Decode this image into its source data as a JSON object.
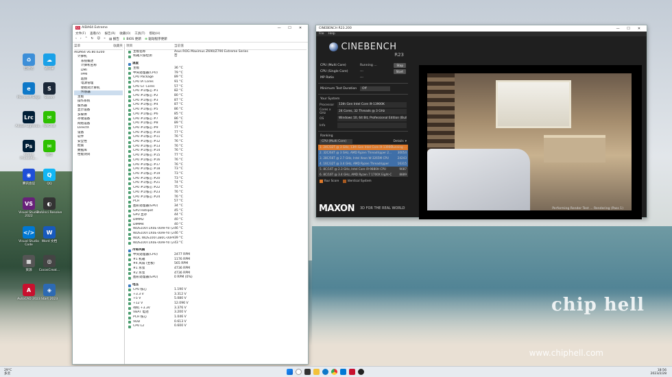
{
  "desktop": {
    "icons": [
      {
        "label": "回收站",
        "color": "#3d8fd8",
        "glyph": "♻"
      },
      {
        "label": "通讯录",
        "color": "#1aa1e8",
        "glyph": "☁"
      },
      {
        "label": "Microsoft Edge",
        "color": "#0d78c8",
        "glyph": "e"
      },
      {
        "label": "Steam",
        "color": "#1b2838",
        "glyph": "S"
      },
      {
        "label": "Adobe Lightroo...",
        "color": "#001e36",
        "glyph": "Lrc"
      },
      {
        "label": "WeChat",
        "color": "#2dc100",
        "glyph": "✉"
      },
      {
        "label": "Adobe Photosho...",
        "color": "#001e36",
        "glyph": "Ps"
      },
      {
        "label": "微信",
        "color": "#2dc100",
        "glyph": "✉"
      },
      {
        "label": "腾讯会议",
        "color": "#1f4fd8",
        "glyph": "◉"
      },
      {
        "label": "QQ",
        "color": "#12b7f5",
        "glyph": "Q"
      },
      {
        "label": "Visual Studio 2022",
        "color": "#68217a",
        "glyph": "VS"
      },
      {
        "label": "DaVinci Resolve",
        "color": "#333",
        "glyph": "◐"
      },
      {
        "label": "Visual Studio Code",
        "color": "#0078d4",
        "glyph": "</>"
      },
      {
        "label": "Word 文档",
        "color": "#185abd",
        "glyph": "W"
      },
      {
        "label": "资源",
        "color": "#555",
        "glyph": "▦"
      },
      {
        "label": "CocosCreat...",
        "color": "#444",
        "glyph": "◎"
      },
      {
        "label": "AutoCAD 2023",
        "color": "#c8102e",
        "glyph": "A"
      },
      {
        "label": "Start 2023",
        "color": "#2d6ab3",
        "glyph": "◈"
      }
    ],
    "watermark": "chip hell",
    "watermark_url": "www.chiphell.com"
  },
  "aida": {
    "title": "AIDA64 Extreme",
    "menu": [
      "文件(F)",
      "查看(V)",
      "报告(R)",
      "收藏(O)",
      "工具(T)",
      "帮助(H)"
    ],
    "toolbar": {
      "report": "报告",
      "bios": "BIOS 更新",
      "driver": "驱动程序更新"
    },
    "tree_header": [
      "菜单",
      "收藏夹"
    ],
    "tree": [
      "AIDA64 v6.80.6200",
      "计算机",
      "系统概述",
      "计算机名称",
      "DMI",
      "IPMI",
      "超频",
      "电源管理",
      "便携式计算机",
      "传感器",
      "主板",
      "操作系统",
      "服务器",
      "显示设备",
      "多媒体",
      "存储设备",
      "网络设备",
      "DirectX",
      "设备",
      "软件",
      "安全性",
      "配置",
      "数据库",
      "性能测试"
    ],
    "list_header": [
      "项目",
      "当前值"
    ],
    "rows": [
      {
        "n": "主板名称",
        "v": "Asus ROG Maximus Z690/Z790 Extreme Series"
      },
      {
        "n": "机箱入侵检测",
        "v": "否"
      },
      {
        "n": "温度",
        "v": "",
        "sec": true
      },
      {
        "n": "主板",
        "v": "36 °C"
      },
      {
        "n": "中央处理器(CPU)",
        "v": "79 °C"
      },
      {
        "n": "CPU Package",
        "v": "89 °C"
      },
      {
        "n": "CPU IA Cores",
        "v": "91 °C"
      },
      {
        "n": "CPU GT Cores",
        "v": "57 °C"
      },
      {
        "n": "CPU #1/核心 #1",
        "v": "82 °C"
      },
      {
        "n": "CPU #1/核心 #2",
        "v": "80 °C"
      },
      {
        "n": "CPU #1/核心 #3",
        "v": "87 °C"
      },
      {
        "n": "CPU #1/核心 #4",
        "v": "87 °C"
      },
      {
        "n": "CPU #1/核心 #5",
        "v": "86 °C"
      },
      {
        "n": "CPU #1/核心 #6",
        "v": "85 °C"
      },
      {
        "n": "CPU #1/核心 #7",
        "v": "86 °C"
      },
      {
        "n": "CPU #1/核心 #8",
        "v": "89 °C"
      },
      {
        "n": "CPU #1/核心 #9",
        "v": "77 °C"
      },
      {
        "n": "CPU #1/核心 #10",
        "v": "77 °C"
      },
      {
        "n": "CPU #1/核心 #11",
        "v": "76 °C"
      },
      {
        "n": "CPU #1/核心 #12",
        "v": "76 °C"
      },
      {
        "n": "CPU #1/核心 #13",
        "v": "76 °C"
      },
      {
        "n": "CPU #1/核心 #14",
        "v": "76 °C"
      },
      {
        "n": "CPU #1/核心 #15",
        "v": "77 °C"
      },
      {
        "n": "CPU #1/核心 #16",
        "v": "76 °C"
      },
      {
        "n": "CPU #1/核心 #17",
        "v": "76 °C"
      },
      {
        "n": "CPU #1/核心 #18",
        "v": "73 °C"
      },
      {
        "n": "CPU #1/核心 #19",
        "v": "73 °C"
      },
      {
        "n": "CPU #1/核心 #20",
        "v": "73 °C"
      },
      {
        "n": "CPU #1/核心 #21",
        "v": "74 °C"
      },
      {
        "n": "CPU #1/核心 #22",
        "v": "75 °C"
      },
      {
        "n": "CPU #1/核心 #23",
        "v": "76 °C"
      },
      {
        "n": "CPU #1/核心 #24",
        "v": "76 °C"
      },
      {
        "n": "PCH",
        "v": "57 °C"
      },
      {
        "n": "图形处理器(GPU)",
        "v": "34 °C"
      },
      {
        "n": "GPU Hotspot",
        "v": "45 °C"
      },
      {
        "n": "GPU 显存",
        "v": "44 °C"
      },
      {
        "n": "DIMM2",
        "v": "40 °C"
      },
      {
        "n": "DIMM4",
        "v": "40 °C"
      },
      {
        "n": "WDS100T1X0E-00AFY0 (204...",
        "v": "46 °C"
      },
      {
        "n": "WDS100T1X0E-00AFY0 (204...",
        "v": "46 °C"
      },
      {
        "n": "WDC WDS100T2B0C-00PXH0",
        "v": "39 °C"
      },
      {
        "n": "WDS100T1X0E-00AFY0 (204...",
        "v": "43 °C"
      },
      {
        "n": "冷却风扇",
        "v": "",
        "sec": true
      },
      {
        "n": "中央处理器(CPU)",
        "v": "2477 RPM"
      },
      {
        "n": "#1 机箱",
        "v": "1176 RPM"
      },
      {
        "n": "#4 风扇 (主板)",
        "v": "565 RPM"
      },
      {
        "n": "#1 水泵",
        "v": "4736 RPM"
      },
      {
        "n": "#2 水泵",
        "v": "4736 RPM"
      },
      {
        "n": "图形处理器(GPU)",
        "v": "0 RPM  (0%)"
      },
      {
        "n": "电压",
        "v": "",
        "sec": true
      },
      {
        "n": "CPU 核心",
        "v": "1.190 V"
      },
      {
        "n": "+3.3 V",
        "v": "3.312 V"
      },
      {
        "n": "+5 V",
        "v": "5.080 V"
      },
      {
        "n": "+12 V",
        "v": "12.096 V"
      },
      {
        "n": "待机 +3.3V",
        "v": "3.376 V"
      },
      {
        "n": "VBAT 电池",
        "v": "3.200 V"
      },
      {
        "n": "PCH 核心",
        "v": "1.046 V"
      },
      {
        "n": "VDD",
        "v": "0.613 V"
      },
      {
        "n": "CPU L2",
        "v": "0.600 V"
      }
    ]
  },
  "cinebench": {
    "title": "CINEBENCH R23.200",
    "menu": [
      "File",
      "Help"
    ],
    "logo": "CINEBENCH",
    "version": "R23",
    "tests": [
      {
        "k": "CPU (Multi Core)",
        "v": "Running ...",
        "btn": "Stop"
      },
      {
        "k": "CPU (Single Core)",
        "v": "---",
        "btn": "Start"
      },
      {
        "k": "MP Ratio",
        "v": "---",
        "btn": ""
      }
    ],
    "duration_label": "Minimum Test Duration",
    "duration_value": "Off",
    "system_title": "Your System",
    "system": [
      {
        "k": "Processor",
        "v": "13th Gen Intel Core i9-13900K"
      },
      {
        "k": "Cores x GHz",
        "v": "24 Cores, 32 Threads @ 3 GHz"
      },
      {
        "k": "OS",
        "v": "Windows 10, 64 Bit, Professional Edition (Build 2"
      },
      {
        "k": "Info",
        "v": ""
      }
    ],
    "ranking_title": "Ranking",
    "ranking_select": "CPU (Multi Core)",
    "details": "Details",
    "ranking": [
      {
        "t": "1. 24C/32T @ 3 GHz, 13th Gen Intel Core i9-13900K",
        "s": "Running ...",
        "c": "#e07a2a"
      },
      {
        "t": "2. 32C/64T @ 3 GHz, AMD Ryzen Threadripper 2...",
        "s": "30054",
        "c": "#3f6fa8"
      },
      {
        "t": "3. 28C/56T @ 2.7 GHz, Intel Xeon W-3265M CPU",
        "s": "24243",
        "c": "#3f6fa8"
      },
      {
        "t": "4. 16C/32T @ 3.4 GHz, AMD Ryzen Threadripper",
        "s": "16315",
        "c": "#3f6fa8"
      },
      {
        "t": "5. 8C/16T @ 2.3 GHz, Intel Core i9-9880H CPU",
        "s": "9087",
        "c": "#3a3a3a"
      },
      {
        "t": "6. 8C/16T @ 3.4 GHz, AMD Ryzen 7 1700X Eight-C",
        "s": "8889",
        "c": "#3a3a3a"
      }
    ],
    "legend": [
      "Your Score",
      "Identical System"
    ],
    "footer_brand": "MAXON",
    "footer_tag": "3D FOR THE REAL WORLD",
    "status": "Performing Render Test ... Rendering (Pass 1)"
  },
  "taskbar": {
    "weather": "29°C",
    "weather_sub": "多云",
    "time": "18:56",
    "date": "2023/2/28"
  }
}
